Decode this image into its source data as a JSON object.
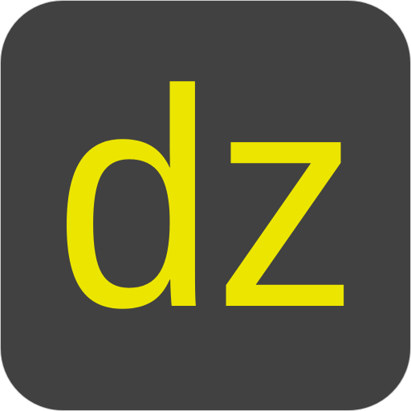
{
  "app_icon": {
    "text": "dz",
    "background_color": "#414141",
    "text_color": "#ECE500"
  }
}
